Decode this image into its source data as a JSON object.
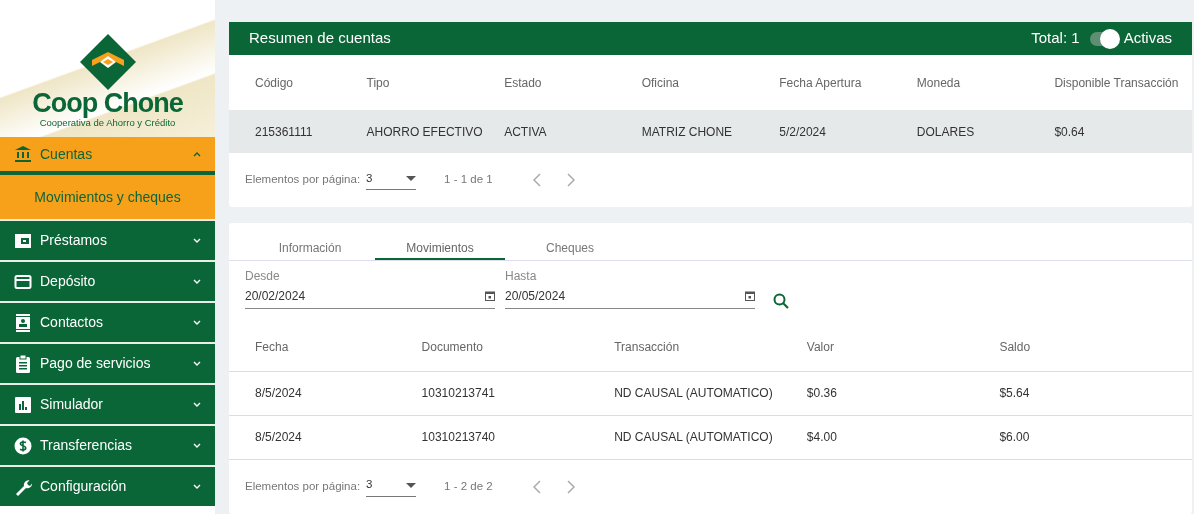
{
  "logo": {
    "name": "Coop Chone",
    "subtitle": "Cooperativa de Ahorro y Crédito"
  },
  "sidebar": {
    "items": [
      {
        "label": "Cuentas",
        "selected": true,
        "expanded": true,
        "children": [
          {
            "label": "Movimientos y cheques",
            "selected": true
          }
        ]
      },
      {
        "label": "Préstamos",
        "selected": false,
        "expanded": false
      },
      {
        "label": "Depósito",
        "selected": false,
        "expanded": false
      },
      {
        "label": "Contactos",
        "selected": false,
        "expanded": false
      },
      {
        "label": "Pago de servicios",
        "selected": false,
        "expanded": false
      },
      {
        "label": "Simulador",
        "selected": false,
        "expanded": false
      },
      {
        "label": "Transferencias",
        "selected": false,
        "expanded": false
      },
      {
        "label": "Configuración",
        "selected": false,
        "expanded": false
      }
    ]
  },
  "accounts": {
    "title": "Resumen de cuentas",
    "total": "Total: 1",
    "toggle": {
      "label": "Activas",
      "on": true
    },
    "columns": [
      "Código",
      "Tipo",
      "Estado",
      "Oficina",
      "Fecha Apertura",
      "Moneda",
      "Disponible Transacción"
    ],
    "rows": [
      {
        "selected": true,
        "cells": [
          "215361111",
          "AHORRO EFECTIVO",
          "ACTIVA",
          "MATRIZ CHONE",
          "5/2/2024",
          "DOLARES",
          "$0.64"
        ]
      }
    ],
    "paginator": {
      "label": "Elementos por página:",
      "page_size": "3",
      "range": "1 - 1 de 1"
    }
  },
  "detail": {
    "tabs": [
      {
        "label": "Información",
        "selected": false
      },
      {
        "label": "Movimientos",
        "selected": true
      },
      {
        "label": "Cheques",
        "selected": false
      }
    ],
    "filters": [
      {
        "label": "Desde",
        "value": "20/02/2024"
      },
      {
        "label": "Hasta",
        "value": "20/05/2024"
      }
    ],
    "columns": [
      "Fecha",
      "Documento",
      "Transacción",
      "Valor",
      "Saldo"
    ],
    "rows": [
      {
        "cells": [
          "8/5/2024",
          "10310213741",
          "ND CAUSAL (AUTOMATICO)",
          "$0.36",
          "$5.64"
        ]
      },
      {
        "cells": [
          "8/5/2024",
          "10310213740",
          "ND CAUSAL (AUTOMATICO)",
          "$4.00",
          "$6.00"
        ]
      }
    ],
    "paginator": {
      "label": "Elementos por página:",
      "page_size": "3",
      "range": "1 - 2 de 2"
    }
  }
}
